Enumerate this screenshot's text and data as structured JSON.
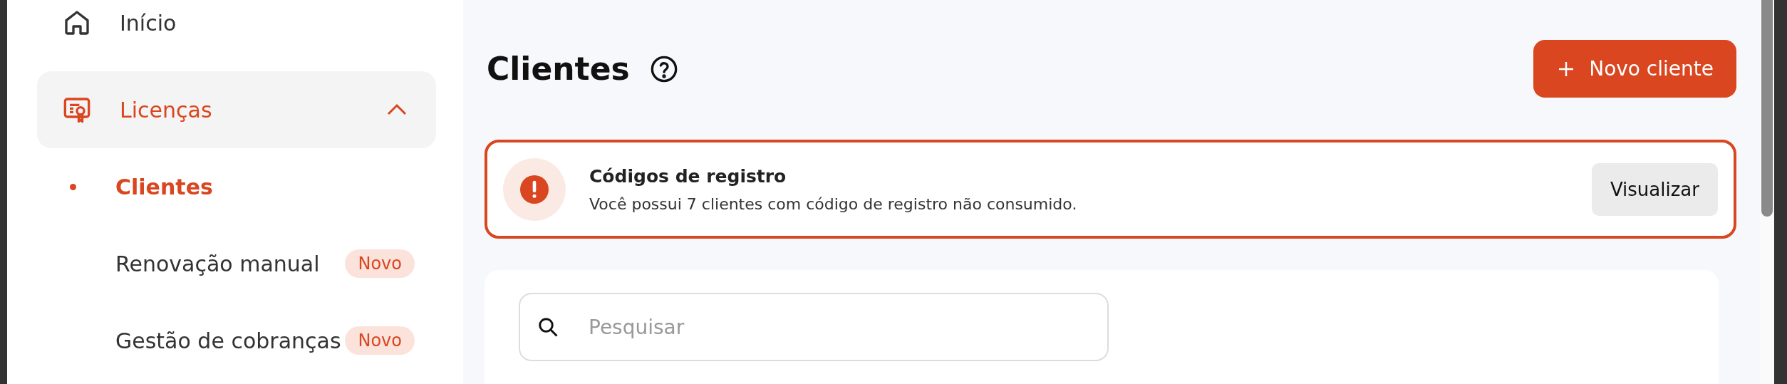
{
  "sidebar": {
    "items": [
      {
        "kind": "link",
        "label": "Início",
        "selected": false
      },
      {
        "kind": "group",
        "label": "Licenças",
        "selected": true,
        "expanded": true,
        "children": [
          {
            "label": "Clientes",
            "selected": true
          },
          {
            "label": "Renovação manual",
            "selected": false,
            "badge": "Novo"
          },
          {
            "label": "Gestão de cobranças",
            "selected": false,
            "badge": "Novo"
          }
        ]
      }
    ]
  },
  "header": {
    "title": "Clientes",
    "new_button": "Novo cliente"
  },
  "alert": {
    "title": "Códigos de registro",
    "message": "Você possui 7 clientes com código de registro não consumido.",
    "action": "Visualizar"
  },
  "search": {
    "placeholder": "Pesquisar"
  }
}
